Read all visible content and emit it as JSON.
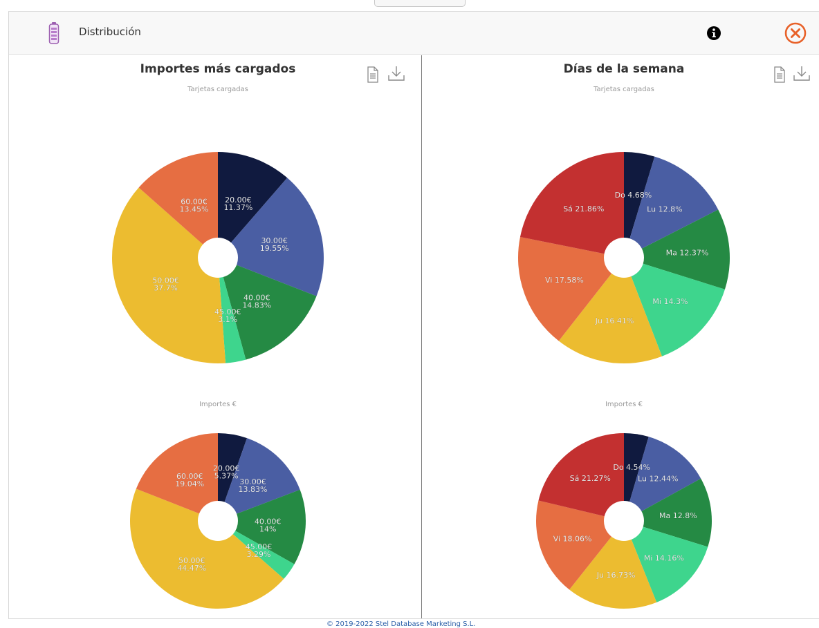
{
  "header": {
    "title": "Distribución",
    "icons": {
      "battery": "battery-icon",
      "info": "info-icon",
      "close": "close-circle-icon"
    },
    "close_color": "#e8622a"
  },
  "footer": {
    "text": "© 2019-2022 Stel Database Marketing S.L."
  },
  "colors": {
    "navy": "#101a3f",
    "blue": "#4a5ea3",
    "green": "#258a44",
    "mint": "#3ed58d",
    "yellow": "#ecbc30",
    "orange": "#e66e42",
    "red": "#c33030"
  },
  "chart_data": [
    {
      "type": "pie",
      "title": "Importes más cargados",
      "subtitle": "Tarjetas cargadas",
      "slices": [
        {
          "label": "20.00€",
          "value": 11.37,
          "display": "11.37%",
          "color": "#101a3f"
        },
        {
          "label": "30.00€",
          "value": 19.55,
          "display": "19.55%",
          "color": "#4a5ea3"
        },
        {
          "label": "40.00€",
          "value": 14.83,
          "display": "14.83%",
          "color": "#258a44"
        },
        {
          "label": "45.00€",
          "value": 3.1,
          "display": "3.1%",
          "color": "#3ed58d"
        },
        {
          "label": "50.00€",
          "value": 37.7,
          "display": "37.7%",
          "color": "#ecbc30"
        },
        {
          "label": "60.00€",
          "value": 13.45,
          "display": "13.45%",
          "color": "#e66e42"
        }
      ]
    },
    {
      "type": "pie",
      "title": "",
      "subtitle": "Importes €",
      "slices": [
        {
          "label": "20.00€",
          "value": 5.37,
          "display": "5.37%",
          "color": "#101a3f"
        },
        {
          "label": "30.00€",
          "value": 13.83,
          "display": "13.83%",
          "color": "#4a5ea3"
        },
        {
          "label": "40.00€",
          "value": 14,
          "display": "14%",
          "color": "#258a44"
        },
        {
          "label": "45.00€",
          "value": 3.29,
          "display": "3.29%",
          "color": "#3ed58d"
        },
        {
          "label": "50.00€",
          "value": 44.47,
          "display": "44.47%",
          "color": "#ecbc30"
        },
        {
          "label": "60.00€",
          "value": 19.04,
          "display": "19.04%",
          "color": "#e66e42"
        }
      ]
    },
    {
      "type": "pie",
      "title": "Días de la semana",
      "subtitle": "Tarjetas cargadas",
      "slices": [
        {
          "label": "Do",
          "value": 4.68,
          "display": "4.68%",
          "color": "#101a3f"
        },
        {
          "label": "Lu",
          "value": 12.8,
          "display": "12.8%",
          "color": "#4a5ea3"
        },
        {
          "label": "Ma",
          "value": 12.37,
          "display": "12.37%",
          "color": "#258a44"
        },
        {
          "label": "Mi",
          "value": 14.3,
          "display": "14.3%",
          "color": "#3ed58d"
        },
        {
          "label": "Ju",
          "value": 16.41,
          "display": "16.41%",
          "color": "#ecbc30"
        },
        {
          "label": "Vi",
          "value": 17.58,
          "display": "17.58%",
          "color": "#e66e42"
        },
        {
          "label": "Sá",
          "value": 21.86,
          "display": "21.86%",
          "color": "#c33030"
        }
      ]
    },
    {
      "type": "pie",
      "title": "",
      "subtitle": "Importes €",
      "slices": [
        {
          "label": "Do",
          "value": 4.54,
          "display": "4.54%",
          "color": "#101a3f"
        },
        {
          "label": "Lu",
          "value": 12.44,
          "display": "12.44%",
          "color": "#4a5ea3"
        },
        {
          "label": "Ma",
          "value": 12.8,
          "display": "12.8%",
          "color": "#258a44"
        },
        {
          "label": "Mi",
          "value": 14.16,
          "display": "14.16%",
          "color": "#3ed58d"
        },
        {
          "label": "Ju",
          "value": 16.73,
          "display": "16.73%",
          "color": "#ecbc30"
        },
        {
          "label": "Vi",
          "value": 18.06,
          "display": "18.06%",
          "color": "#e66e42"
        },
        {
          "label": "Sá",
          "value": 21.27,
          "display": "21.27%",
          "color": "#c33030"
        }
      ]
    }
  ]
}
